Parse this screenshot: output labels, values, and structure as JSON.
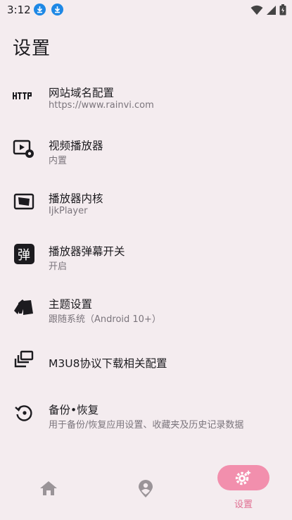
{
  "status_bar": {
    "time": "3:12",
    "icons": [
      "download-notification-icon",
      "download-notification-icon",
      "wifi-icon",
      "signal-icon",
      "battery-icon"
    ]
  },
  "page": {
    "title": "设置"
  },
  "settings": [
    {
      "icon": "http-icon",
      "label": "网站域名配置",
      "value": "https://www.rainvi.com"
    },
    {
      "icon": "video-player-icon",
      "label": "视频播放器",
      "value": "内置"
    },
    {
      "icon": "player-core-icon",
      "label": "播放器内核",
      "value": "IjkPlayer"
    },
    {
      "icon": "danmaku-icon",
      "label": "播放器弹幕开关",
      "value": "开启",
      "icon_text": "弹"
    },
    {
      "icon": "theme-icon",
      "label": "主题设置",
      "value": "跟随系统（Android 10+）"
    },
    {
      "icon": "download-config-icon",
      "label": "M3U8协议下载相关配置",
      "value": ""
    },
    {
      "icon": "backup-restore-icon",
      "label": "备份•恢复",
      "value": "用于备份/恢复应用设置、收藏夹及历史记录数据"
    }
  ],
  "bottom_nav": {
    "items": [
      {
        "icon": "home-icon",
        "label": ""
      },
      {
        "icon": "location-icon",
        "label": ""
      },
      {
        "icon": "settings-icon",
        "label": "设置",
        "active": true
      }
    ]
  },
  "colors": {
    "background": "#f4ecef",
    "accent": "#f28fad",
    "accent_text": "#e06f92",
    "download_badge": "#1e88e5"
  }
}
